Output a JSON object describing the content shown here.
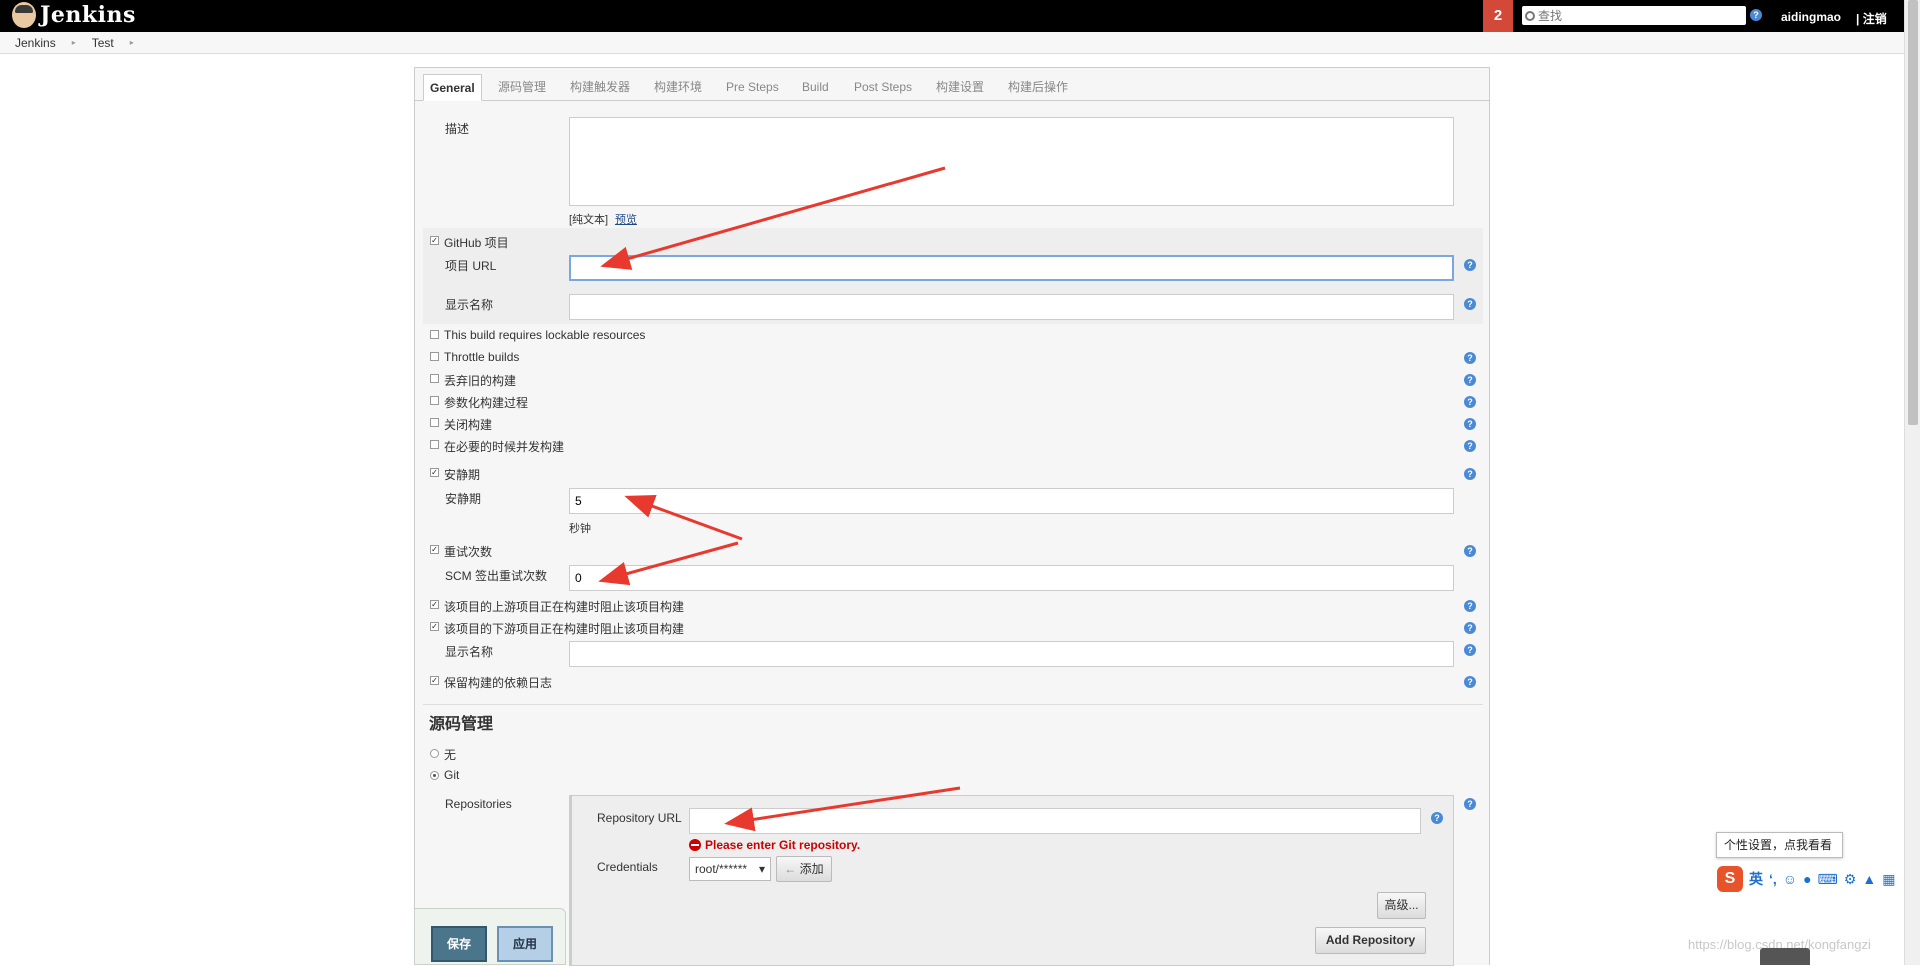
{
  "header": {
    "logo_text": "Jenkins",
    "badge": "2",
    "search_placeholder": "查找",
    "help": "?",
    "user": "aidingmao",
    "logout": "| 注销"
  },
  "breadcrumb": [
    "Jenkins",
    "Test"
  ],
  "tabs": [
    "General",
    "源码管理",
    "构建触发器",
    "构建环境",
    "Pre Steps",
    "Build",
    "Post Steps",
    "构建设置",
    "构建后操作"
  ],
  "general": {
    "description_label": "描述",
    "plain_text": "[纯文本]",
    "preview": "预览",
    "github_project": "GitHub 项目",
    "project_url_label": "项目 URL",
    "project_url_value": "",
    "display_name_label": "显示名称",
    "display_name_value": "",
    "lockable": "This build requires lockable resources",
    "throttle": "Throttle builds",
    "discard_old": "丢弃旧的构建",
    "parameterized": "参数化构建过程",
    "disable": "关闭构建",
    "concurrent": "在必要的时候并发构建",
    "quiet_period": "安静期",
    "quiet_period_label": "安静期",
    "quiet_period_value": "5",
    "seconds": "秒钟",
    "retry_count": "重试次数",
    "scm_retry_label": "SCM 签出重试次数",
    "scm_retry_value": "0",
    "block_upstream": "该项目的上游项目正在构建时阻止该项目构建",
    "block_downstream": "该项目的下游项目正在构建时阻止该项目构建",
    "display_name2_label": "显示名称",
    "keep_dependencies": "保留构建的依赖日志"
  },
  "scm": {
    "title": "源码管理",
    "none": "无",
    "git": "Git",
    "repositories_label": "Repositories",
    "repo_url_label": "Repository URL",
    "repo_url_value": "",
    "error": "Please enter Git repository.",
    "credentials_label": "Credentials",
    "credentials_value": "root/******",
    "add_button": "添加",
    "advanced_button": "高级...",
    "add_repository_button": "Add Repository"
  },
  "bottom": {
    "save": "保存",
    "apply": "应用"
  },
  "ime": {
    "tip": "个性设置，点我看看",
    "logo": "S",
    "lang": "英"
  },
  "watermark": "https://blog.csdn.net/kongfangzi",
  "colors": {
    "header_bg": "#000000",
    "badge_bg": "#d24939",
    "help_blue": "#4a8ad4",
    "error_red": "#cc0000",
    "save_bg": "#4b758b",
    "apply_bg": "#b4cfe6",
    "arrow_red": "#e8392f"
  }
}
